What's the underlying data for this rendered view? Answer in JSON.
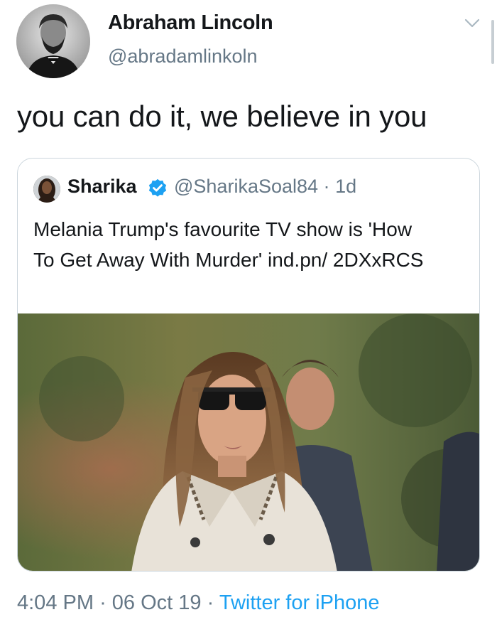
{
  "tweet": {
    "display_name": "Abraham Lincoln",
    "handle": "@abradamlinkoln",
    "text": "you can do it, we believe in you",
    "avatar_icon": "lincoln-portrait"
  },
  "quoted_tweet": {
    "display_name": "Sharika",
    "handle": "@SharikaSoal84",
    "separator": "·",
    "age": "1d",
    "text": "Melania Trump's favourite TV show is 'How To Get Away With Murder' ind.pn/ 2DXxRCS",
    "verified_icon": "verified-badge-icon",
    "image_description_icon": "photo"
  },
  "footer": {
    "time": "4:04 PM",
    "date": "06 Oct 19",
    "separator": "·",
    "source": "Twitter for iPhone"
  },
  "colors": {
    "text": "#14171a",
    "secondary": "#657786",
    "link": "#1da1f2",
    "border": "#ccd6dd"
  }
}
